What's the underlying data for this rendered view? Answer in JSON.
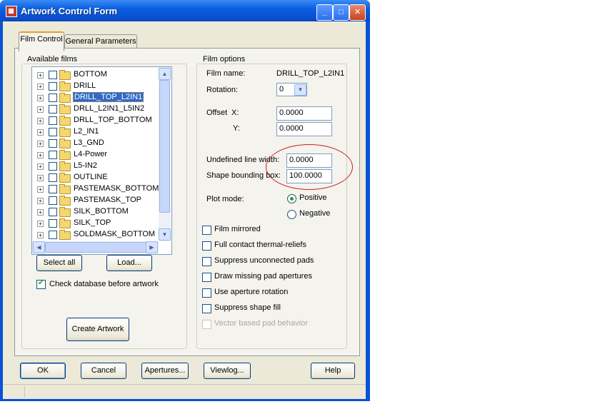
{
  "window": {
    "title": "Artwork Control Form",
    "controls": [
      "_",
      "□",
      "✕"
    ]
  },
  "tabs": [
    {
      "label": "Film Control",
      "active": true
    },
    {
      "label": "General Parameters",
      "active": false
    }
  ],
  "available_films": {
    "legend": "Available films",
    "items": [
      {
        "label": "BOTTOM",
        "selected": false
      },
      {
        "label": "DRILL",
        "selected": false
      },
      {
        "label": "DRILL_TOP_L2IN1",
        "selected": true
      },
      {
        "label": "DRLL_L2IN1_L5IN2",
        "selected": false
      },
      {
        "label": "DRLL_TOP_BOTTOM",
        "selected": false
      },
      {
        "label": "L2_IN1",
        "selected": false
      },
      {
        "label": "L3_GND",
        "selected": false
      },
      {
        "label": "L4-Power",
        "selected": false
      },
      {
        "label": "L5-IN2",
        "selected": false
      },
      {
        "label": "OUTLINE",
        "selected": false
      },
      {
        "label": "PASTEMASK_BOTTOM",
        "selected": false
      },
      {
        "label": "PASTEMASK_TOP",
        "selected": false
      },
      {
        "label": "SILK_BOTTOM",
        "selected": false
      },
      {
        "label": "SILK_TOP",
        "selected": false
      },
      {
        "label": "SOLDMASK_BOTTOM",
        "selected": false
      }
    ],
    "select_all": "Select all",
    "load": "Load...",
    "check_db_label": "Check database before artwork",
    "check_db_checked": true,
    "create_artwork": "Create Artwork"
  },
  "film_options": {
    "legend": "Film options",
    "film_name_label": "Film name:",
    "film_name_value": "DRILL_TOP_L2IN1",
    "rotation_label": "Rotation:",
    "rotation_value": "0",
    "offset_label": "Offset",
    "offset_x_label": "X:",
    "offset_x_value": "0.0000",
    "offset_y_label": "Y:",
    "offset_y_value": "0.0000",
    "undefined_line_width_label": "Undefined line width:",
    "undefined_line_width_value": "0.0000",
    "shape_bounding_box_label": "Shape bounding box:",
    "shape_bounding_box_value": "100.0000",
    "plot_mode_label": "Plot mode:",
    "plot_positive": "Positive",
    "plot_negative": "Negative",
    "plot_mode_selected": "Positive",
    "options": [
      {
        "label": "Film mirrored",
        "checked": false,
        "enabled": true
      },
      {
        "label": "Full contact thermal-reliefs",
        "checked": false,
        "enabled": true
      },
      {
        "label": "Suppress unconnected pads",
        "checked": false,
        "enabled": true
      },
      {
        "label": "Draw missing pad apertures",
        "checked": false,
        "enabled": true
      },
      {
        "label": "Use aperture rotation",
        "checked": false,
        "enabled": true
      },
      {
        "label": "Suppress shape fill",
        "checked": false,
        "enabled": true
      },
      {
        "label": "Vector based pad behavior",
        "checked": false,
        "enabled": false
      }
    ]
  },
  "bottom_buttons": {
    "ok": "OK",
    "cancel": "Cancel",
    "apertures": "Apertures...",
    "viewlog": "Viewlog...",
    "help": "Help"
  },
  "colors": {
    "titlebar": "#0b5fe0",
    "selection": "#316ac5",
    "annotation_circle": "#cc2222"
  }
}
